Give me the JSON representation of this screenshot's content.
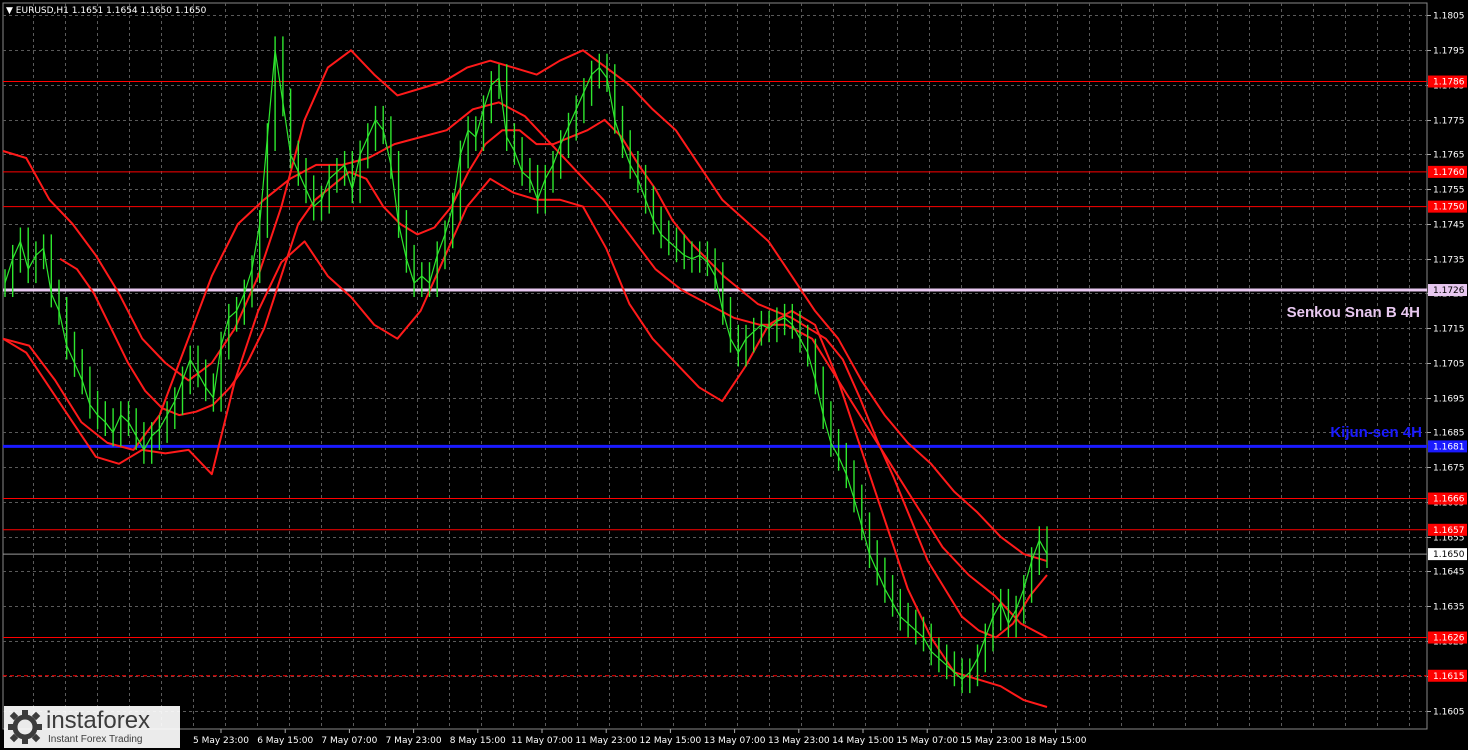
{
  "header": {
    "symbol": "EURUSD,H1",
    "ohlc": "1.1651 1.1654 1.1650 1.1650"
  },
  "labels": {
    "senkou": "Senkou Snan B 4H",
    "kijun": "Kijun-sen 4H"
  },
  "watermark": {
    "name": "instaforex",
    "tagline": "Instant Forex Trading"
  },
  "colors": {
    "background": "#000000",
    "grid": "#5a5a5a",
    "price": "#2ee62e",
    "ichimoku": "#ff1a1a",
    "level": "#ff0000",
    "kijun": "#1a1aff",
    "senkou": "#e8c8f0",
    "label_text": "#ffffff"
  },
  "chart_data": {
    "type": "line",
    "title": "EURUSD,H1",
    "ylim": [
      1.16,
      1.181
    ],
    "y_ticks": [
      "1.1805",
      "1.1795",
      "1.1785",
      "1.1775",
      "1.1765",
      "1.1755",
      "1.1745",
      "1.1735",
      "1.1725",
      "1.1715",
      "1.1705",
      "1.1695",
      "1.1685",
      "1.1675",
      "1.1665",
      "1.1655",
      "1.1645",
      "1.1635",
      "1.1625",
      "1.1615",
      "1.1605"
    ],
    "x_ticks": [
      "5 May 23:00",
      "6 May 15:00",
      "7 May 07:00",
      "7 May 23:00",
      "8 May 15:00",
      "11 May 07:00",
      "11 May 23:00",
      "12 May 15:00",
      "13 May 07:00",
      "13 May 23:00",
      "14 May 15:00",
      "15 May 07:00",
      "15 May 23:00",
      "18 May 15:00"
    ],
    "levels": [
      {
        "value": 1.1786,
        "label": "1.1786",
        "style": "solid"
      },
      {
        "value": 1.176,
        "label": "1.1760",
        "style": "solid"
      },
      {
        "value": 1.175,
        "label": "1.1750",
        "style": "solid"
      },
      {
        "value": 1.1666,
        "label": "1.1666",
        "style": "solid"
      },
      {
        "value": 1.1657,
        "label": "1.1657",
        "style": "solid"
      },
      {
        "value": 1.1626,
        "label": "1.1626",
        "style": "solid"
      },
      {
        "value": 1.1615,
        "label": "1.1615",
        "style": "dashed"
      }
    ],
    "senkou_span_b": {
      "value": 1.1726,
      "label": "1.1726"
    },
    "kijun_sen": {
      "value": 1.1681,
      "label": "1.1681"
    },
    "current_price": {
      "value": 1.165,
      "label": "1.1650"
    },
    "series": [
      {
        "kind": "price",
        "values": [
          1.1728,
          1.1735,
          1.174,
          1.1732,
          1.1736,
          1.1738,
          1.1725,
          1.172,
          1.171,
          1.1705,
          1.17,
          1.1693,
          1.169,
          1.1688,
          1.1685,
          1.169,
          1.1688,
          1.1684,
          1.168,
          1.1684,
          1.1686,
          1.169,
          1.1694,
          1.17,
          1.1706,
          1.1702,
          1.1698,
          1.1695,
          1.171,
          1.1718,
          1.172,
          1.1725,
          1.1732,
          1.1745,
          1.177,
          1.1795,
          1.178,
          1.1765,
          1.176,
          1.1755,
          1.175,
          1.1752,
          1.1758,
          1.176,
          1.1762,
          1.1755,
          1.1765,
          1.177,
          1.1775,
          1.1772,
          1.1762,
          1.1745,
          1.1735,
          1.1728,
          1.173,
          1.1728,
          1.1736,
          1.1742,
          1.175,
          1.1765,
          1.1772,
          1.177,
          1.1778,
          1.1785,
          1.1787,
          1.177,
          1.1766,
          1.176,
          1.1758,
          1.1752,
          1.1758,
          1.1762,
          1.1768,
          1.1773,
          1.1778,
          1.1783,
          1.1788,
          1.179,
          1.1787,
          1.1775,
          1.1768,
          1.1762,
          1.1758,
          1.1752,
          1.1746,
          1.1742,
          1.174,
          1.1738,
          1.1736,
          1.1735,
          1.1736,
          1.1734,
          1.173,
          1.172,
          1.1712,
          1.1708,
          1.1712,
          1.1714,
          1.1716,
          1.1715,
          1.1717,
          1.1718,
          1.1716,
          1.1712,
          1.1708,
          1.17,
          1.169,
          1.1682,
          1.1678,
          1.1673,
          1.1666,
          1.1658,
          1.165,
          1.1645,
          1.164,
          1.1636,
          1.1632,
          1.163,
          1.1628,
          1.1626,
          1.1622,
          1.162,
          1.1618,
          1.1616,
          1.1614,
          1.1616,
          1.162,
          1.1626,
          1.1632,
          1.1636,
          1.163,
          1.1634,
          1.164,
          1.1648,
          1.1654,
          1.165
        ]
      },
      {
        "kind": "tenkan",
        "values": [
          1.1735,
          1.1732,
          1.1725,
          1.1715,
          1.1705,
          1.1697,
          1.1692,
          1.169,
          1.1691,
          1.1693,
          1.1698,
          1.1705,
          1.1715,
          1.173,
          1.1745,
          1.1752,
          1.1756,
          1.176,
          1.1758,
          1.175,
          1.1745,
          1.1742,
          1.1744,
          1.175,
          1.176,
          1.1768,
          1.1772,
          1.1772,
          1.1768,
          1.1768,
          1.177,
          1.1772,
          1.1775,
          1.177,
          1.1762,
          1.1755,
          1.1746,
          1.174,
          1.1735,
          1.173,
          1.1726,
          1.1722,
          1.172,
          1.1718,
          1.1715,
          1.1712,
          1.1706,
          1.1695,
          1.1683,
          1.1672,
          1.166,
          1.1648,
          1.164,
          1.1632,
          1.1628,
          1.1626,
          1.163,
          1.1638,
          1.1644
        ]
      },
      {
        "kind": "kijun",
        "values": [
          1.1712,
          1.171,
          1.17,
          1.1688,
          1.1682,
          1.168,
          1.169,
          1.171,
          1.173,
          1.1745,
          1.1752,
          1.1758,
          1.1762,
          1.1762,
          1.1764,
          1.1768,
          1.177,
          1.1772,
          1.1778,
          1.178,
          1.1776,
          1.1768,
          1.176,
          1.1752,
          1.1742,
          1.1732,
          1.1726,
          1.1722,
          1.1718,
          1.1716,
          1.1716,
          1.1712,
          1.17,
          1.1688,
          1.1676,
          1.1664,
          1.1652,
          1.1644,
          1.1638,
          1.163,
          1.1626
        ]
      },
      {
        "kind": "upper-band",
        "values": [
          1.1766,
          1.1764,
          1.1752,
          1.1745,
          1.1736,
          1.1725,
          1.1712,
          1.1705,
          1.17,
          1.1705,
          1.1715,
          1.173,
          1.175,
          1.1775,
          1.179,
          1.1795,
          1.1788,
          1.1782,
          1.1784,
          1.1786,
          1.179,
          1.1792,
          1.179,
          1.1788,
          1.1792,
          1.1795,
          1.179,
          1.1785,
          1.1778,
          1.1772,
          1.1762,
          1.1752,
          1.1746,
          1.174,
          1.173,
          1.172,
          1.1712,
          1.17,
          1.169,
          1.1682,
          1.1676,
          1.1668,
          1.1662,
          1.1655,
          1.165,
          1.1648
        ]
      },
      {
        "kind": "lower-band",
        "values": [
          1.1712,
          1.1708,
          1.1698,
          1.1688,
          1.1678,
          1.1676,
          1.168,
          1.1679,
          1.168,
          1.1673,
          1.17,
          1.172,
          1.1734,
          1.174,
          1.173,
          1.1724,
          1.1716,
          1.1712,
          1.172,
          1.1735,
          1.175,
          1.1758,
          1.1754,
          1.1752,
          1.1752,
          1.175,
          1.1738,
          1.1722,
          1.1712,
          1.1705,
          1.1698,
          1.1694,
          1.1704,
          1.1716,
          1.172,
          1.1716,
          1.17,
          1.168,
          1.166,
          1.164,
          1.1626,
          1.1616,
          1.1614,
          1.1612,
          1.1608,
          1.1606
        ]
      }
    ]
  }
}
